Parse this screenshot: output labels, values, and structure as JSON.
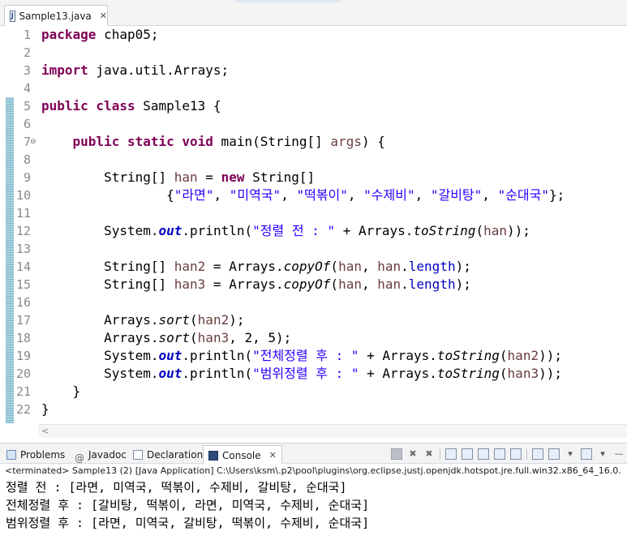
{
  "editor_tab": {
    "label": "Sample13.java",
    "file_icon": "java-file-icon",
    "close_icon": "close-icon"
  },
  "editor": {
    "line_numbers": [
      "1",
      "2",
      "3",
      "4",
      "5",
      "6",
      "7",
      "8",
      "9",
      "10",
      "11",
      "12",
      "13",
      "14",
      "15",
      "16",
      "17",
      "18",
      "19",
      "20",
      "21",
      "22"
    ],
    "code": {
      "l1_kw": "package",
      "l1_rest": " chap05;",
      "l3_kw": "import",
      "l3_rest": " java.util.Arrays;",
      "l5_kw": "public class",
      "l5_rest": " Sample13 {",
      "l7_indent": "    ",
      "l7_kw": "public static void",
      "l7_a": " main(String[] ",
      "l7_var": "args",
      "l7_b": ") {",
      "l9_a": "        String[] ",
      "l9_var": "han",
      "l9_b": " = ",
      "l9_kw": "new",
      "l9_c": " String[]",
      "l10_a": "                {",
      "l10_s1": "\"라면\"",
      "l10_s2": "\"미역국\"",
      "l10_s3": "\"떡볶이\"",
      "l10_s4": "\"수제비\"",
      "l10_s5": "\"갈비탕\"",
      "l10_s6": "\"순대국\"",
      "l10_sep": ", ",
      "l10_end": "};",
      "l12_a": "        System.",
      "l12_out": "out",
      "l12_b": ".println(",
      "l12_str": "\"정렬 전 : \"",
      "l12_c": " + Arrays.",
      "l12_m": "toString",
      "l12_d": "(",
      "l12_var": "han",
      "l12_e": "));",
      "l14_a": "        String[] ",
      "l14_var": "han2",
      "l14_b": " = Arrays.",
      "l14_m": "copyOf",
      "l14_c": "(",
      "l14_v1": "han",
      "l14_d": ", ",
      "l14_v2": "han",
      "l14_e": ".",
      "l14_f": "length",
      "l14_g": ");",
      "l15_a": "        String[] ",
      "l15_var": "han3",
      "l15_b": " = Arrays.",
      "l15_m": "copyOf",
      "l15_c": "(",
      "l15_v1": "han",
      "l15_d": ", ",
      "l15_v2": "han",
      "l15_e": ".",
      "l15_f": "length",
      "l15_g": ");",
      "l17_a": "        Arrays.",
      "l17_m": "sort",
      "l17_b": "(",
      "l17_var": "han2",
      "l17_c": ");",
      "l18_a": "        Arrays.",
      "l18_m": "sort",
      "l18_b": "(",
      "l18_var": "han3",
      "l18_c": ", 2, 5);",
      "l19_a": "        System.",
      "l19_out": "out",
      "l19_b": ".println(",
      "l19_str": "\"전체정렬 후 : \"",
      "l19_c": " + Arrays.",
      "l19_m": "toString",
      "l19_d": "(",
      "l19_var": "han2",
      "l19_e": "));",
      "l20_a": "        System.",
      "l20_out": "out",
      "l20_b": ".println(",
      "l20_str": "\"범위정렬 후 : \"",
      "l20_c": " + Arrays.",
      "l20_m": "toString",
      "l20_d": "(",
      "l20_var": "han3",
      "l20_e": "));",
      "l21": "    }",
      "l22": "}"
    },
    "fold_icon": "collapse-icon"
  },
  "console_tabs": {
    "problems": "Problems",
    "javadoc": "Javadoc",
    "declaration": "Declaration",
    "console": "Console"
  },
  "console": {
    "header": "<terminated> Sample13 (2) [Java Application] C:\\Users\\ksm\\.p2\\pool\\plugins\\org.eclipse.justj.openjdk.hotspot.jre.full.win32.x86_64_16.0.",
    "output": [
      "정렬 전 : [라면, 미역국, 떡볶이, 수제비, 갈비탕, 순대국]",
      "전체정렬 후 : [갈비탕, 떡볶이, 라면, 미역국, 수제비, 순대국]",
      "범위정렬 후 : [라면, 미역국, 갈비탕, 떡볶이, 수제비, 순대국]"
    ]
  },
  "colors": {
    "keyword": "#7f0055",
    "string": "#2a00ff",
    "field": "#0000c0",
    "local_var": "#6a3e3e"
  }
}
